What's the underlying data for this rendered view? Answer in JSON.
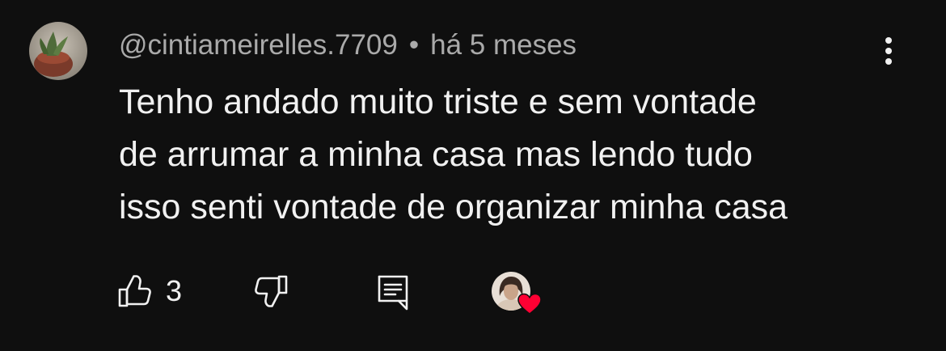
{
  "comment": {
    "author": "@cintiameirelles.7709",
    "separator": "•",
    "timestamp": "há 5 meses",
    "text_lines": [
      "Tenho andado muito triste e sem vontade",
      "de arrumar a minha casa mas lendo tudo",
      "isso senti vontade de organizar minha casa"
    ],
    "like_count": "3"
  },
  "icons": {
    "like": "thumbs-up-icon",
    "dislike": "thumbs-down-icon",
    "reply": "reply-comment-icon",
    "menu": "vertical-ellipsis-icon",
    "creator_heart": "heart-icon"
  },
  "colors": {
    "background": "#0f0f0f",
    "text_primary": "#f1f1f1",
    "text_secondary": "#aaaaaa",
    "heart": "#ff0033"
  }
}
